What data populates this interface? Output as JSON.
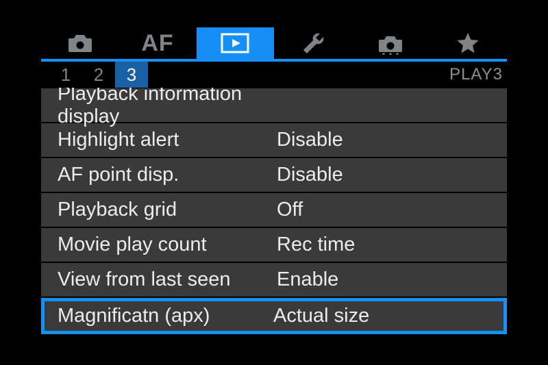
{
  "tabs": {
    "af_label": "AF"
  },
  "subtabs": {
    "pages": [
      "1",
      "2",
      "3"
    ],
    "active_index": 2,
    "page_label": "PLAY3"
  },
  "menu": {
    "items": [
      {
        "label": "Playback information display",
        "value": ""
      },
      {
        "label": "Highlight alert",
        "value": "Disable"
      },
      {
        "label": "AF point disp.",
        "value": "Disable"
      },
      {
        "label": "Playback grid",
        "value": "Off"
      },
      {
        "label": "Movie play count",
        "value": "Rec time"
      },
      {
        "label": "View from last seen",
        "value": "Enable"
      },
      {
        "label": "Magnificatn (apx)",
        "value": "Actual size"
      }
    ],
    "selected_index": 6
  }
}
